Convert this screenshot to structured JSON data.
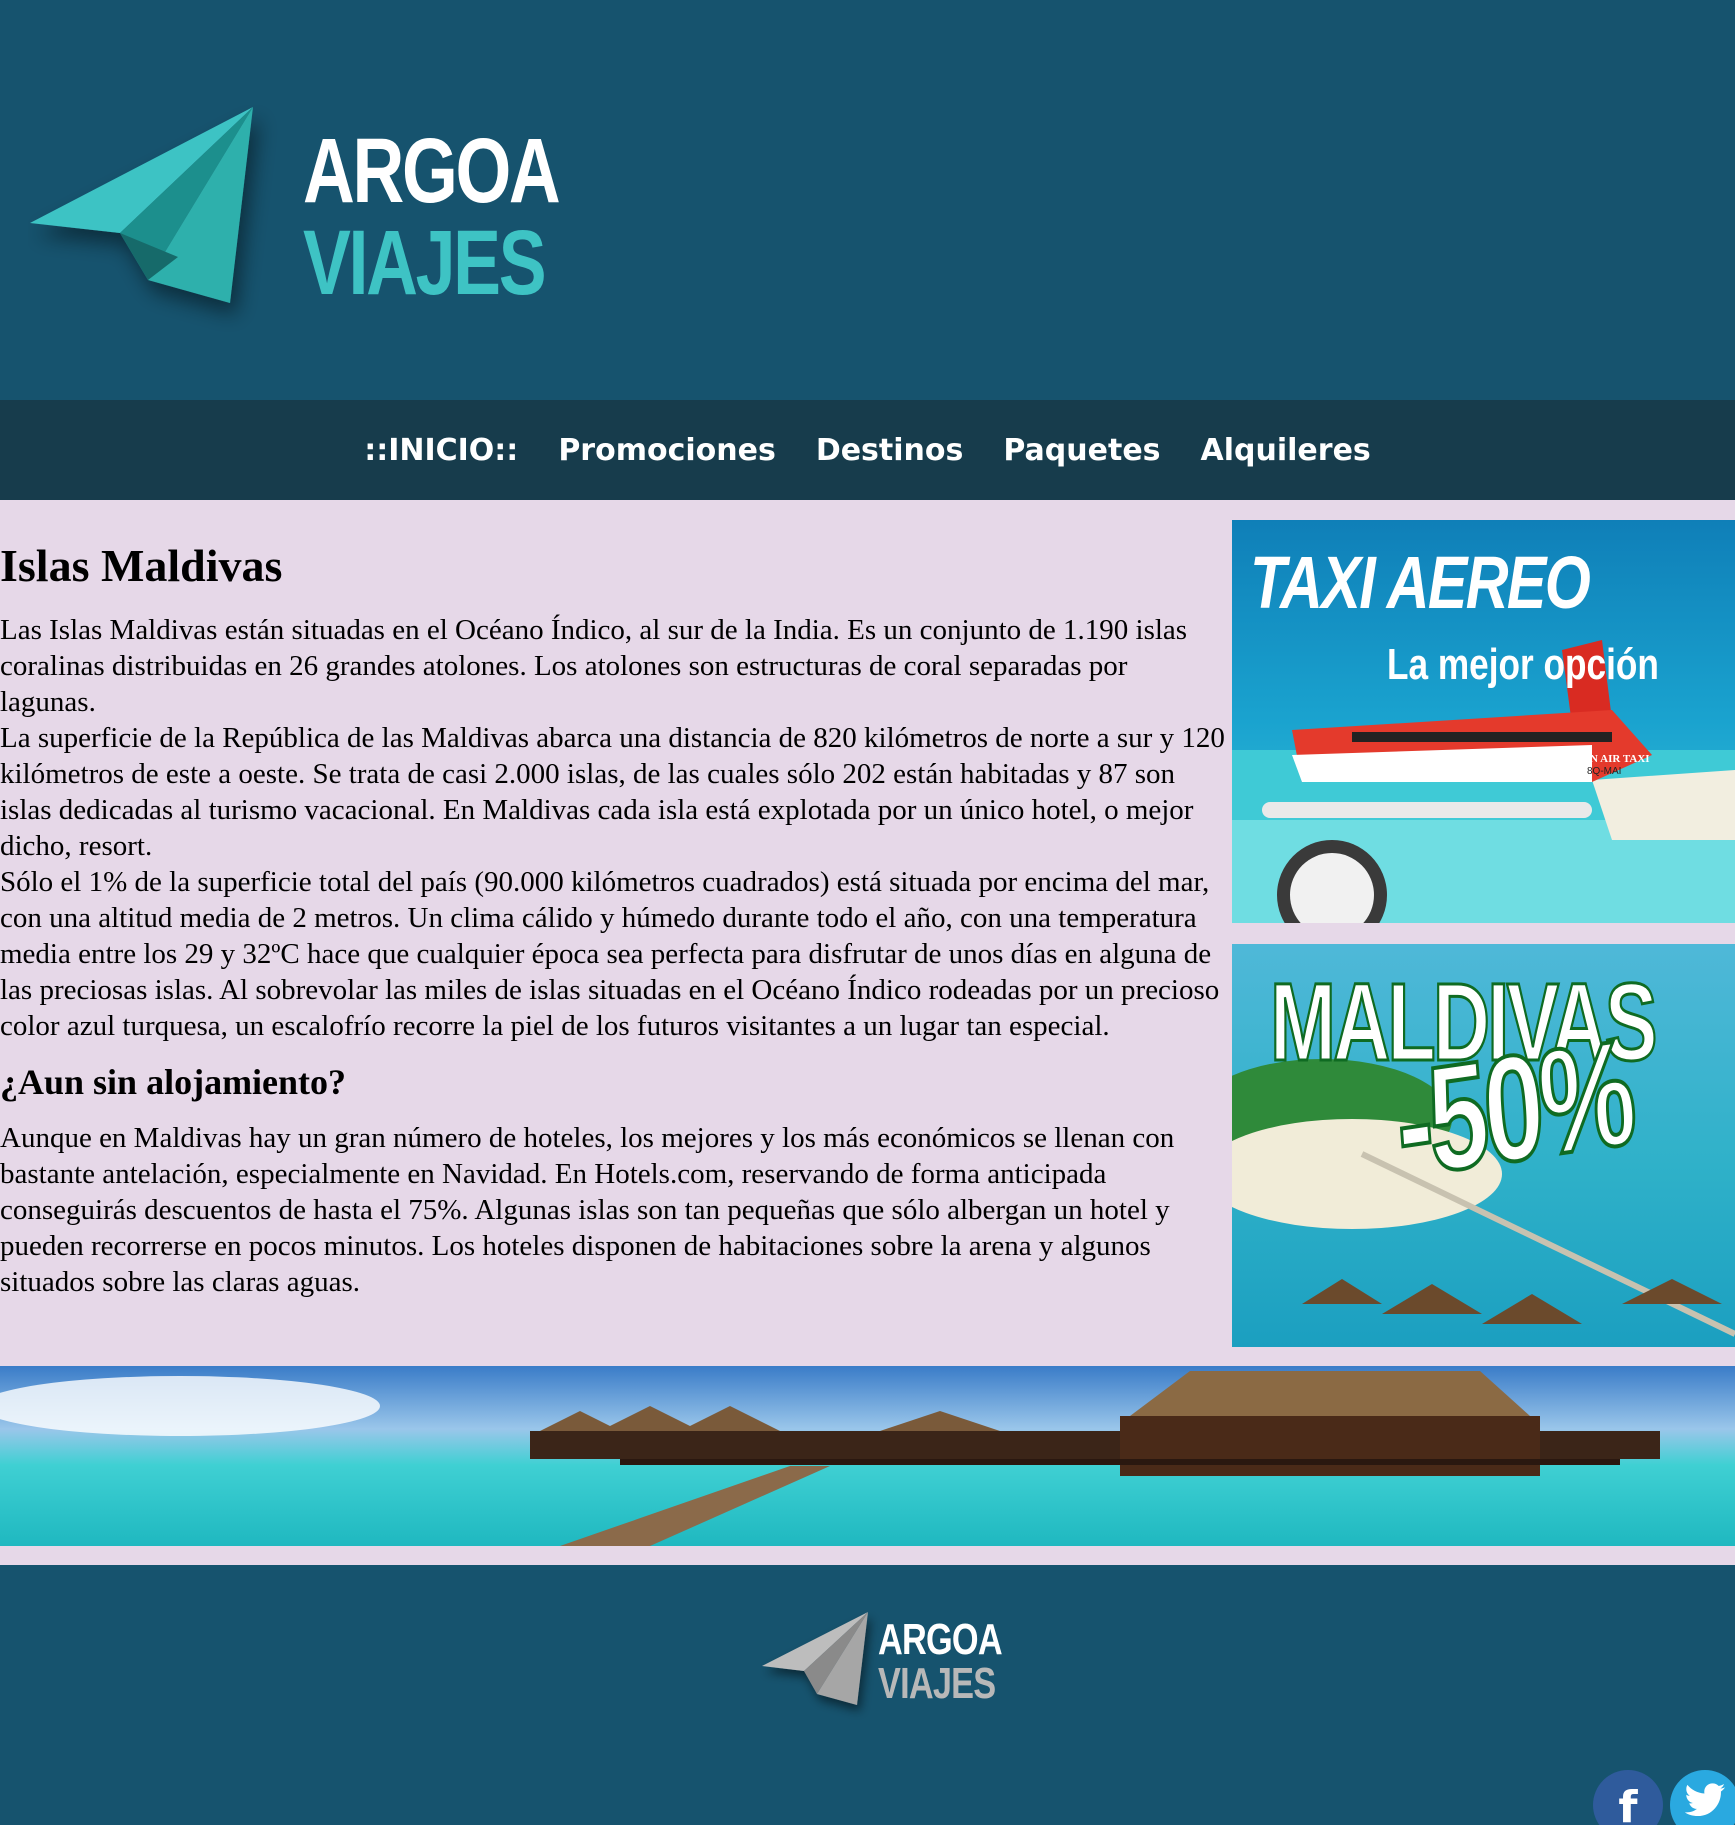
{
  "header": {
    "logo_line1": "ARGOA",
    "logo_line2": "VIAJES"
  },
  "nav": {
    "items": [
      "::INICIO::",
      "Promociones",
      "Destinos",
      "Paquetes",
      "Alquileres"
    ]
  },
  "article": {
    "title": "Islas Maldivas",
    "paragraph1": "Las Islas Maldivas están situadas en el Océano Índico, al sur de la India. Es un conjunto de 1.190 islas coralinas distribuidas en 26 grandes atolones. Los atolones son estructuras de coral separadas por lagunas.",
    "paragraph2": "La superficie de la República de las Maldivas abarca una distancia de 820 kilómetros de norte a sur y 120 kilómetros de este a oeste. Se trata de casi 2.000 islas, de las cuales sólo 202 están habitadas y 87 son islas dedicadas al turismo vacacional. En Maldivas cada isla está explotada por un único hotel, o mejor dicho, resort.",
    "paragraph3": "Sólo el 1% de la superficie total del país (90.000 kilómetros cuadrados) está situada por encima del mar, con una altitud media de 2 metros. Un clima cálido y húmedo durante todo el año, con una temperatura media entre los 29 y 32ºC hace que cualquier época sea perfecta para disfrutar de unos días en alguna de las preciosas islas. Al sobrevolar las miles de islas situadas en el Océano Índico rodeadas por un precioso color azul turquesa, un escalofrío recorre la piel de los futuros visitantes a un lugar tan especial.",
    "subtitle": "¿Aun sin alojamiento?",
    "paragraph4": "Aunque en Maldivas hay un gran número de hoteles, los mejores y los más económicos se llenan con bastante antelación, especialmente en Navidad. En Hotels.com, reservando de forma anticipada conseguirás descuentos de hasta el 75%. Algunas islas son tan pequeñas que sólo albergan un hotel y pueden recorrerse en pocos minutos. Los hoteles disponen de habitaciones sobre la arena y algunos situados sobre las claras aguas."
  },
  "ads": {
    "ad1_title": "TAXI AEREO",
    "ad1_subtitle": "La mejor opción",
    "ad1_plane_text": "MALDIVIAN AIR TAXI",
    "ad1_reg": "8Q-MAI",
    "ad2_title": "MALDIVAS",
    "ad2_discount": "-50%"
  },
  "footer": {
    "logo_line1": "ARGOA",
    "logo_line2": "VIAJES",
    "facebook_icon": "f",
    "twitter_icon": "twitter-bird"
  },
  "colors": {
    "header_bg": "#16536e",
    "nav_bg": "#173c4c",
    "content_bg": "#e6d8e8",
    "logo_accent": "#3ec3c4"
  }
}
